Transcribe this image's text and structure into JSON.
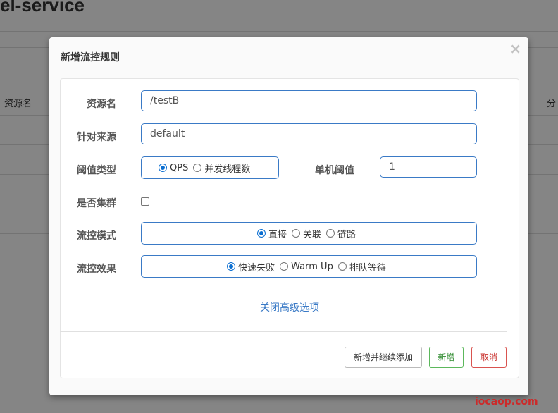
{
  "background": {
    "title": "el-service",
    "column_left": "资源名",
    "column_right": "分"
  },
  "modal": {
    "title": "新增流控规则",
    "close_glyph": "×",
    "fields": {
      "resource": {
        "label": "资源名",
        "value": "/testB"
      },
      "origin": {
        "label": "针对来源",
        "value": "default"
      },
      "threshold_type": {
        "label": "阈值类型",
        "options": [
          "QPS",
          "并发线程数"
        ],
        "selected": "QPS"
      },
      "single_threshold": {
        "label": "单机阈值",
        "value": "1"
      },
      "cluster": {
        "label": "是否集群",
        "checked": false
      },
      "flow_mode": {
        "label": "流控模式",
        "options": [
          "直接",
          "关联",
          "链路"
        ],
        "selected": "直接"
      },
      "flow_effect": {
        "label": "流控效果",
        "options": [
          "快速失败",
          "Warm Up",
          "排队等待"
        ],
        "selected": "快速失败"
      }
    },
    "advanced_link": "关闭高级选项",
    "buttons": {
      "add_continue": "新增并继续添加",
      "add": "新增",
      "cancel": "取消"
    }
  },
  "watermark": "iocaop.com"
}
